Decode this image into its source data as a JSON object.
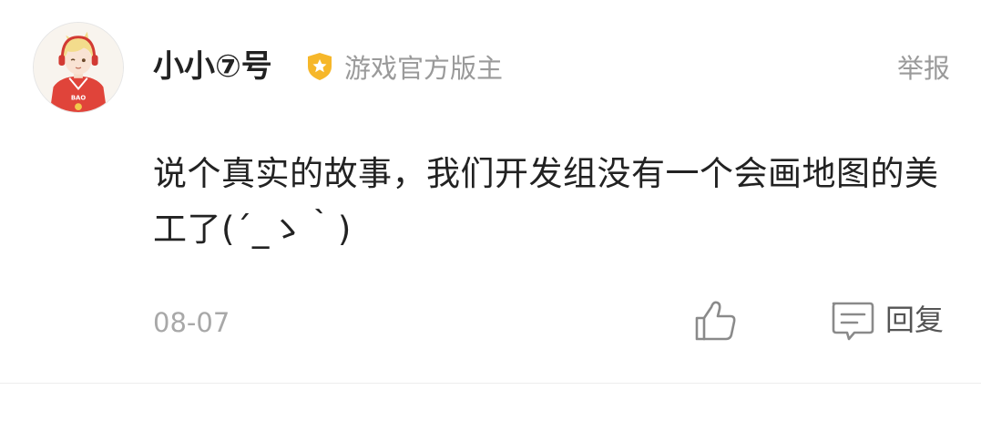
{
  "comment": {
    "user": {
      "name": "小小⑦号",
      "role": "游戏官方版主",
      "avatar": "anime-boy-red-hoodie-avatar"
    },
    "report_label": "举报",
    "text": "说个真实的故事，我们开发组没有一个会画地图的美工了(´_ゝ｀)",
    "date": "08-07",
    "reply_label": "回复",
    "icons": {
      "badge": "verified-shield-icon",
      "like": "thumbs-up-icon",
      "reply": "comment-bubble-icon"
    },
    "colors": {
      "badge_fill": "#f6b72a",
      "muted_text": "#9a9a9a",
      "main_text": "#222222",
      "icon_stroke": "#8a8a8a"
    }
  }
}
